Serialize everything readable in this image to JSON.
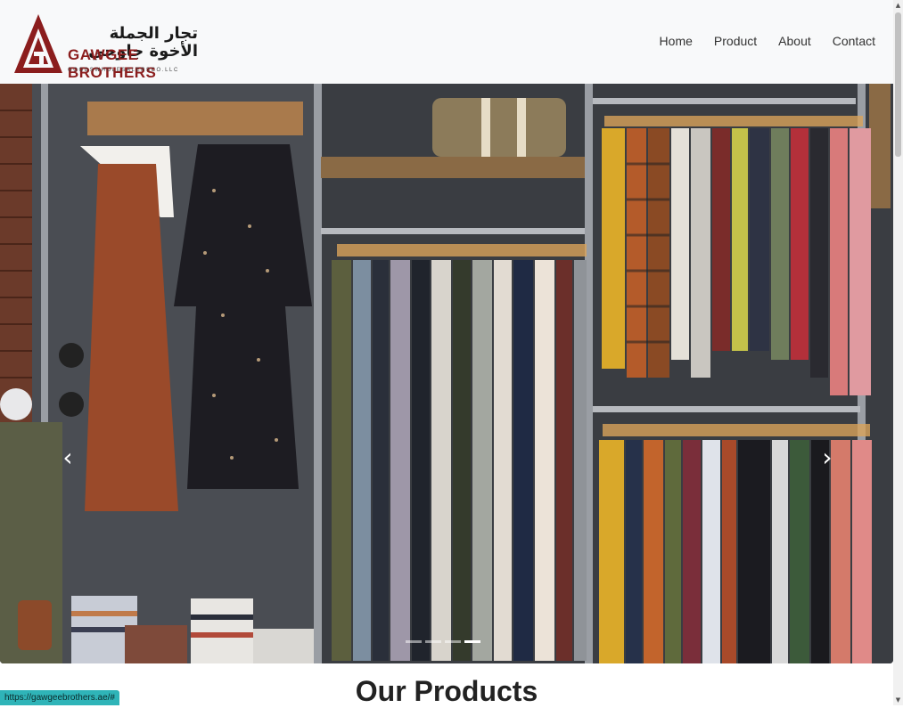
{
  "brand": {
    "arabic_name": "تجار الجملة الأخوة جاوجي",
    "english_name": "GAWGEE BROTHERS",
    "tagline": "GOODSWHOLESALERSCO.LLC",
    "colors": {
      "primary": "#8b1d1d"
    }
  },
  "nav": {
    "items": [
      {
        "label": "Home"
      },
      {
        "label": "Product"
      },
      {
        "label": "About"
      },
      {
        "label": "Contact"
      }
    ]
  },
  "carousel": {
    "prev_icon": "chevron-left-icon",
    "next_icon": "chevron-right-icon",
    "prev_glyph": "‹",
    "next_glyph": "›",
    "slide_count": 4,
    "active_slide": 4
  },
  "main": {
    "section_title": "Our Products"
  },
  "status_bar": {
    "url": "https://gawgeebrothers.ae/#"
  }
}
